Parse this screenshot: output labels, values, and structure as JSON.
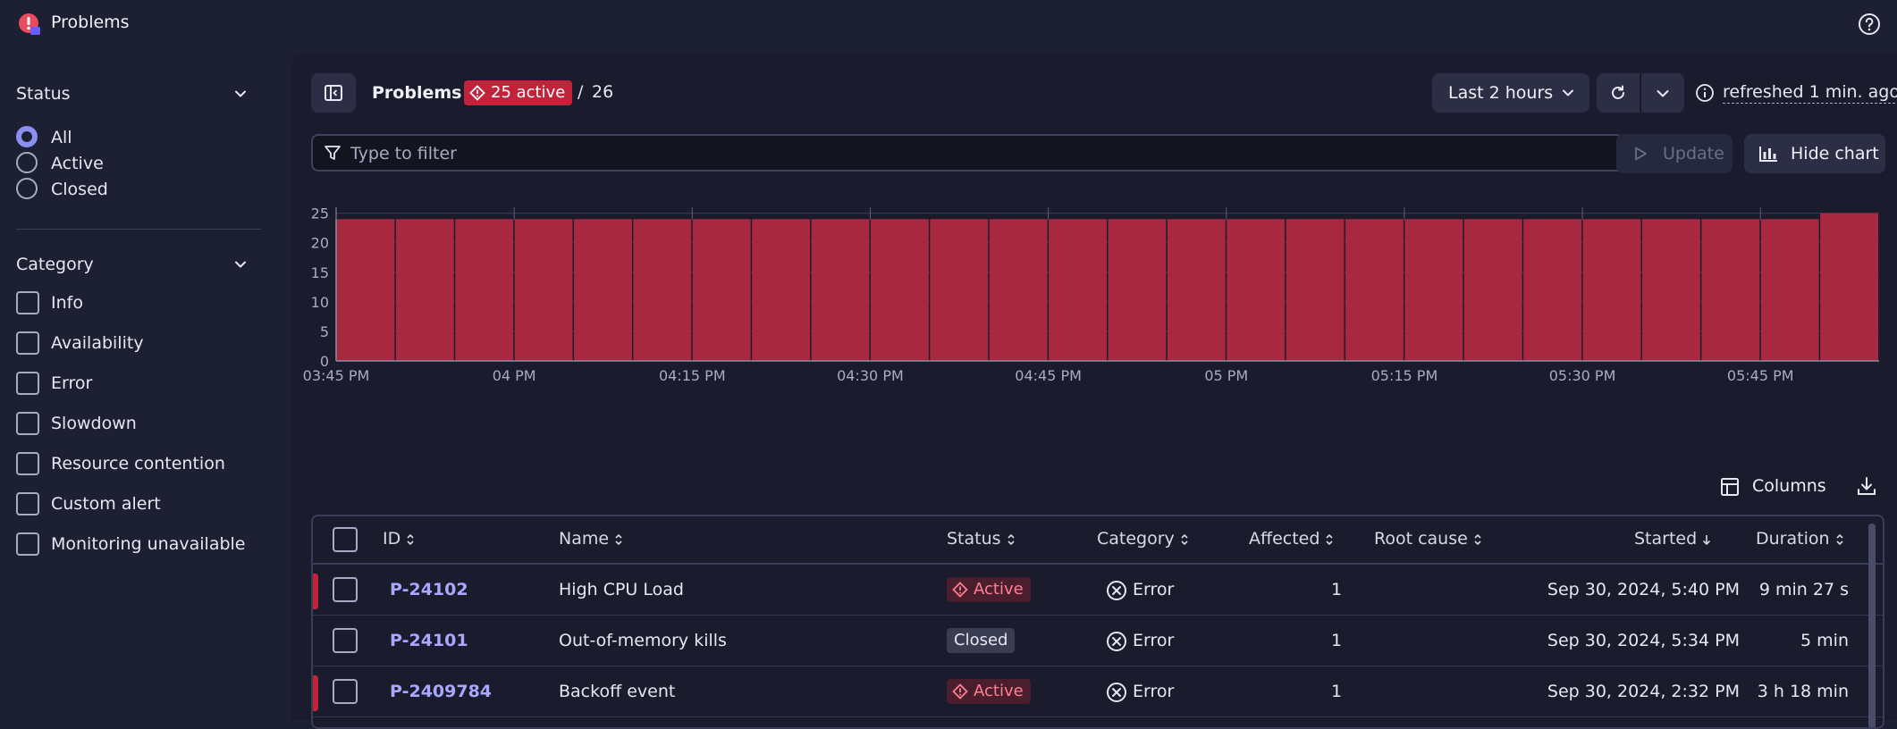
{
  "app": {
    "title": "Problems"
  },
  "sidebar": {
    "status": {
      "title": "Status",
      "options": [
        {
          "label": "All",
          "selected": true
        },
        {
          "label": "Active",
          "selected": false
        },
        {
          "label": "Closed",
          "selected": false
        }
      ]
    },
    "category": {
      "title": "Category",
      "options": [
        {
          "label": "Info"
        },
        {
          "label": "Availability"
        },
        {
          "label": "Error"
        },
        {
          "label": "Slowdown"
        },
        {
          "label": "Resource contention"
        },
        {
          "label": "Custom alert"
        },
        {
          "label": "Monitoring unavailable"
        }
      ]
    }
  },
  "header": {
    "title": "Problems",
    "active_badge": "25 active",
    "slash": "/",
    "total": "26",
    "timeframe": "Last 2 hours",
    "refreshed": "refreshed 1 min. ago"
  },
  "filter": {
    "placeholder": "Type to filter"
  },
  "toolbar": {
    "update_label": "Update",
    "hide_chart_label": "Hide chart",
    "columns_label": "Columns"
  },
  "chart_data": {
    "type": "bar",
    "y_ticks": [
      "0",
      "5",
      "10",
      "15",
      "20",
      "25"
    ],
    "ylim": [
      0,
      26
    ],
    "x_ticks": [
      "03:45 PM",
      "04 PM",
      "04:15 PM",
      "04:30 PM",
      "04:45 PM",
      "05 PM",
      "05:15 PM",
      "05:30 PM",
      "05:45 PM"
    ],
    "series": [
      {
        "color": "#a8283f",
        "values": [
          24,
          24,
          24,
          24,
          24,
          24,
          24,
          24,
          24,
          24,
          24,
          24,
          24,
          24,
          24,
          24,
          24,
          24,
          24,
          24,
          24,
          24,
          24,
          24,
          24,
          25
        ]
      }
    ],
    "grid": true
  },
  "table": {
    "columns": [
      "ID",
      "Name",
      "Status",
      "Category",
      "Affected",
      "Root cause",
      "Started",
      "Duration"
    ],
    "rows": [
      {
        "id": "P-24102",
        "name": "High CPU Load",
        "status": "Active",
        "category": "Error",
        "affected": "1",
        "root_cause": "",
        "started": "Sep 30, 2024, 5:40 PM",
        "duration": "9 min 27 s"
      },
      {
        "id": "P-24101",
        "name": "Out-of-memory kills",
        "status": "Closed",
        "category": "Error",
        "affected": "1",
        "root_cause": "",
        "started": "Sep 30, 2024, 5:34 PM",
        "duration": "5 min"
      },
      {
        "id": "P-2409784",
        "name": "Backoff event",
        "status": "Active",
        "category": "Error",
        "affected": "1",
        "root_cause": "",
        "started": "Sep 30, 2024, 2:32 PM",
        "duration": "3 h 18 min"
      }
    ]
  },
  "colors": {
    "accent": "#8b8ff0",
    "active": "#c3223b",
    "bar": "#a8283f",
    "link": "#a9a7ff"
  }
}
